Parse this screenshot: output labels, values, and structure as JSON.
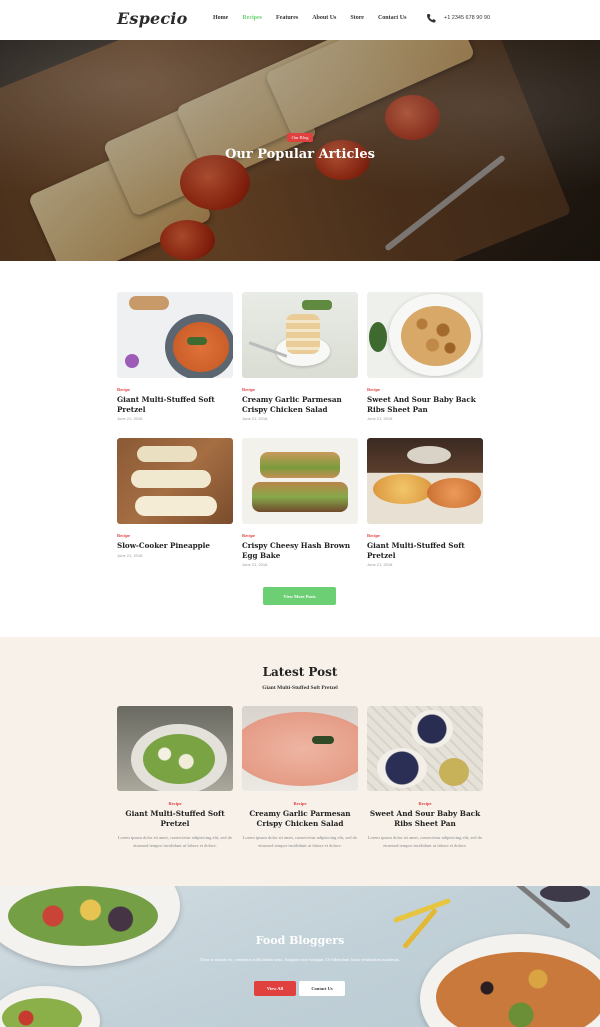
{
  "header": {
    "logo": "Especio",
    "nav": [
      "Home",
      "Recipes",
      "Features",
      "About Us",
      "Store",
      "Contact Us"
    ],
    "active_nav": "Recipes",
    "phone": "+1 2345 678 90 90",
    "phone_icon": "phone-icon"
  },
  "hero": {
    "badge": "Our Blog",
    "title": "Our Popular Articles"
  },
  "articles": [
    {
      "category": "Recipe",
      "title": "Giant Multi-Stuffed Soft Pretzel",
      "date": "June 21, 2018"
    },
    {
      "category": "Recipe",
      "title": "Creamy Garlic Parmesan Crispy Chicken Salad",
      "date": "June 21, 2018"
    },
    {
      "category": "Recipe",
      "title": "Sweet And Sour Baby Back Ribs Sheet Pan",
      "date": "June 21, 2018"
    },
    {
      "category": "Recipe",
      "title": "Slow-Cooker Pineapple",
      "date": "June 21, 2018"
    },
    {
      "category": "Recipe",
      "title": "Crispy Cheesy Hash Brown Egg Bake",
      "date": "June 21, 2018"
    },
    {
      "category": "Recipe",
      "title": "Giant Multi-Stuffed Soft Pretzel",
      "date": "June 21, 2018"
    }
  ],
  "view_more": "View More Posts",
  "latest": {
    "title": "Latest Post",
    "subtitle": "Giant Multi-Stuffed Soft Pretzel",
    "posts": [
      {
        "category": "Recipe",
        "title": "Giant Multi-Stuffed Soft Pretzel",
        "excerpt": "Lorem ipsum dolor sit amet, consectetur adipisicing elit, sed do eiusmod tempor incididunt ut labore et dolore."
      },
      {
        "category": "Recipe",
        "title": "Creamy Garlic Parmesan Crispy Chicken Salad",
        "excerpt": "Lorem ipsum dolor sit amet, consectetur adipisicing elit, sed do eiusmod tempor incididunt ut labore et dolore."
      },
      {
        "category": "Recipe",
        "title": "Sweet And Sour Baby Back Ribs Sheet Pan",
        "excerpt": "Lorem ipsum dolor sit amet, consectetur adipisicing elit, sed do eiusmod tempor incididunt ut labore et dolore."
      }
    ]
  },
  "bloggers": {
    "title": "Food Bloggers",
    "text": "Nam ut mauris ex, venenatis sollicitudin urna. Aliquam erat volutpat. Ut bibendum lacus vestibulum maximus.",
    "btn_primary": "View All",
    "btn_secondary": "Contact Us"
  },
  "colors": {
    "accent_green": "#6ccf74",
    "accent_red": "#e0413f",
    "latest_bg": "#f7f1ea"
  }
}
